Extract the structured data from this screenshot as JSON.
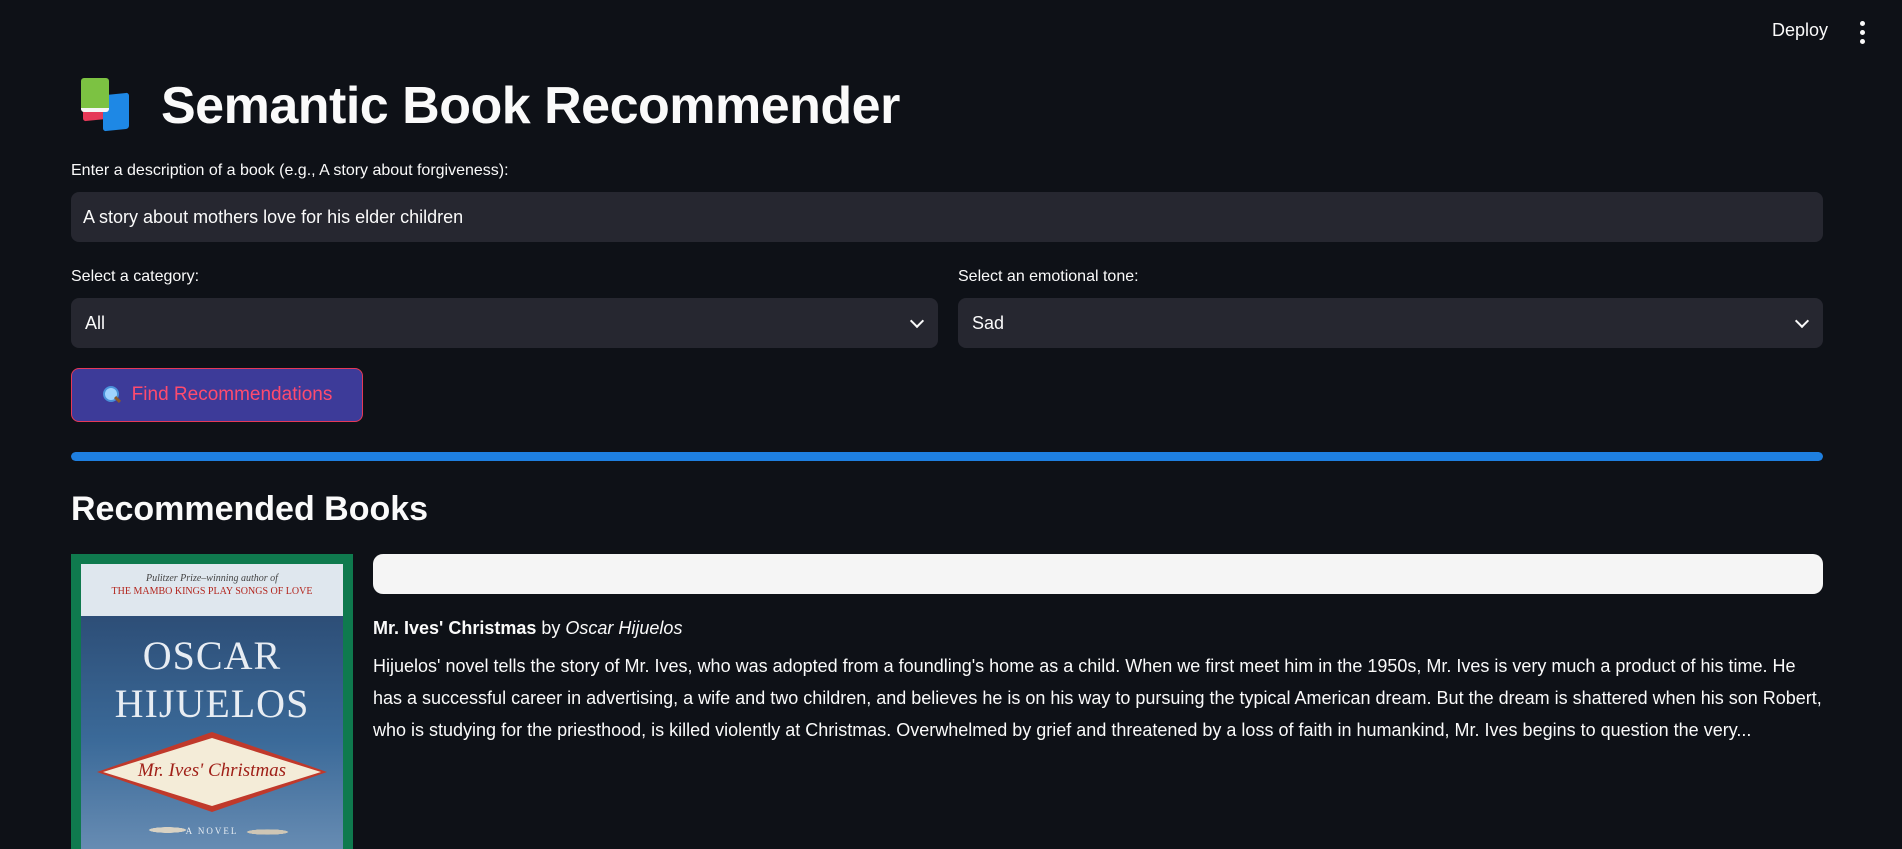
{
  "header": {
    "deploy_label": "Deploy"
  },
  "app": {
    "title": "Semantic Book Recommender",
    "title_icon": "books-icon"
  },
  "query": {
    "label": "Enter a description of a book (e.g., A story about forgiveness):",
    "value": "A story about mothers love for his elder children"
  },
  "category": {
    "label": "Select a category:",
    "selected": "All"
  },
  "tone": {
    "label": "Select an emotional tone:",
    "selected": "Sad"
  },
  "search_button": {
    "label": "Find Recommendations",
    "icon": "magnifying-glass-icon"
  },
  "progress": {
    "fraction": 1.0
  },
  "results": {
    "heading": "Recommended Books",
    "books": [
      {
        "title": "Mr. Ives' Christmas",
        "by": "by",
        "author": "Oscar Hijuelos",
        "description": "Hijuelos' novel tells the story of Mr. Ives, who was adopted from a foundling's home as a child. When we first meet him in the 1950s, Mr. Ives is very much a product of his time. He has a successful career in advertising, a wife and two children, and believes he is on his way to pursuing the typical American dream. But the dream is shattered when his son Robert, who is studying for the priesthood, is killed violently at Christmas. Overwhelmed by grief and threatened by a loss of faith in humankind, Mr. Ives begins to question the very...",
        "cover": {
          "top_line_1": "Pulitzer Prize–winning author of",
          "top_line_2": "THE MAMBO KINGS PLAY SONGS OF LOVE",
          "author_line_1": "OSCAR",
          "author_line_2": "HIJUELOS",
          "title": "Mr. Ives' Christmas",
          "subtitle": "A NOVEL"
        }
      }
    ]
  },
  "colors": {
    "background": "#0e1117",
    "widget": "#262730",
    "accent_red": "#ff4b6e",
    "button_bg": "#3d3b99",
    "progress": "#1e7fe0"
  }
}
